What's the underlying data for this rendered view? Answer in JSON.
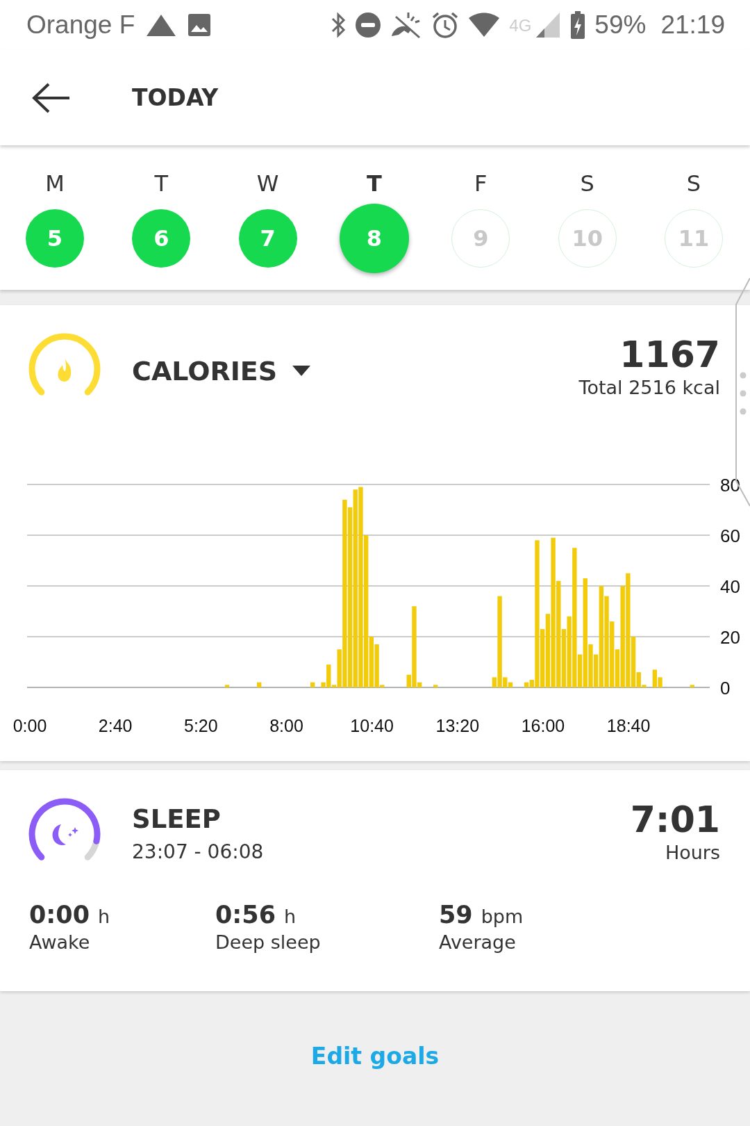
{
  "status_bar": {
    "carrier": "Orange F",
    "network": "4G",
    "battery": "59%",
    "time": "21:19"
  },
  "header": {
    "title": "TODAY"
  },
  "week": [
    {
      "letter": "M",
      "day": "5",
      "completed": true,
      "selected": false
    },
    {
      "letter": "T",
      "day": "6",
      "completed": true,
      "selected": false
    },
    {
      "letter": "W",
      "day": "7",
      "completed": true,
      "selected": false
    },
    {
      "letter": "T",
      "day": "8",
      "completed": true,
      "selected": true
    },
    {
      "letter": "F",
      "day": "9",
      "completed": false,
      "selected": false
    },
    {
      "letter": "S",
      "day": "10",
      "completed": false,
      "selected": false
    },
    {
      "letter": "S",
      "day": "11",
      "completed": false,
      "selected": false
    }
  ],
  "calories": {
    "title": "CALORIES",
    "value": "1167",
    "total": "Total 2516 kcal",
    "chart_data": {
      "type": "bar",
      "grid": true,
      "x": [
        370,
        430,
        530,
        550,
        560,
        570,
        580,
        590,
        600,
        610,
        620,
        630,
        640,
        650,
        660,
        710,
        720,
        730,
        760,
        870,
        880,
        890,
        900,
        930,
        940,
        950,
        960,
        970,
        980,
        990,
        1000,
        1010,
        1020,
        1030,
        1040,
        1050,
        1060,
        1070,
        1080,
        1090,
        1100,
        1110,
        1120,
        1130,
        1140,
        1150,
        1170,
        1180,
        1240
      ],
      "values": [
        1,
        2,
        2,
        2,
        9,
        1,
        15,
        74,
        71,
        78,
        79,
        60,
        20,
        17,
        1,
        5,
        32,
        2,
        1,
        4,
        36,
        4,
        2,
        2,
        3,
        58,
        23,
        29,
        59,
        42,
        23,
        28,
        55,
        13,
        43,
        17,
        13,
        40,
        36,
        26,
        15,
        40,
        45,
        20,
        6,
        1,
        7,
        4,
        1
      ],
      "xlim": [
        0,
        1277
      ],
      "ylim": [
        0,
        80
      ],
      "yticks": [
        0,
        20,
        40,
        60,
        80
      ],
      "xticks": [
        {
          "value": 0,
          "label": "0:00"
        },
        {
          "value": 160,
          "label": "2:40"
        },
        {
          "value": 320,
          "label": "5:20"
        },
        {
          "value": 480,
          "label": "8:00"
        },
        {
          "value": 640,
          "label": "10:40"
        },
        {
          "value": 800,
          "label": "13:20"
        },
        {
          "value": 960,
          "label": "16:00"
        },
        {
          "value": 1120,
          "label": "18:40"
        }
      ]
    }
  },
  "sleep": {
    "title": "SLEEP",
    "range": "23:07 - 06:08",
    "value": "7:01",
    "unit": "Hours",
    "stats": [
      {
        "value": "0:00",
        "unit": "h",
        "label": "Awake"
      },
      {
        "value": "0:56",
        "unit": "h",
        "label": "Deep sleep"
      },
      {
        "value": "59",
        "unit": "bpm",
        "label": "Average"
      }
    ]
  },
  "footer": {
    "link": "Edit goals"
  }
}
